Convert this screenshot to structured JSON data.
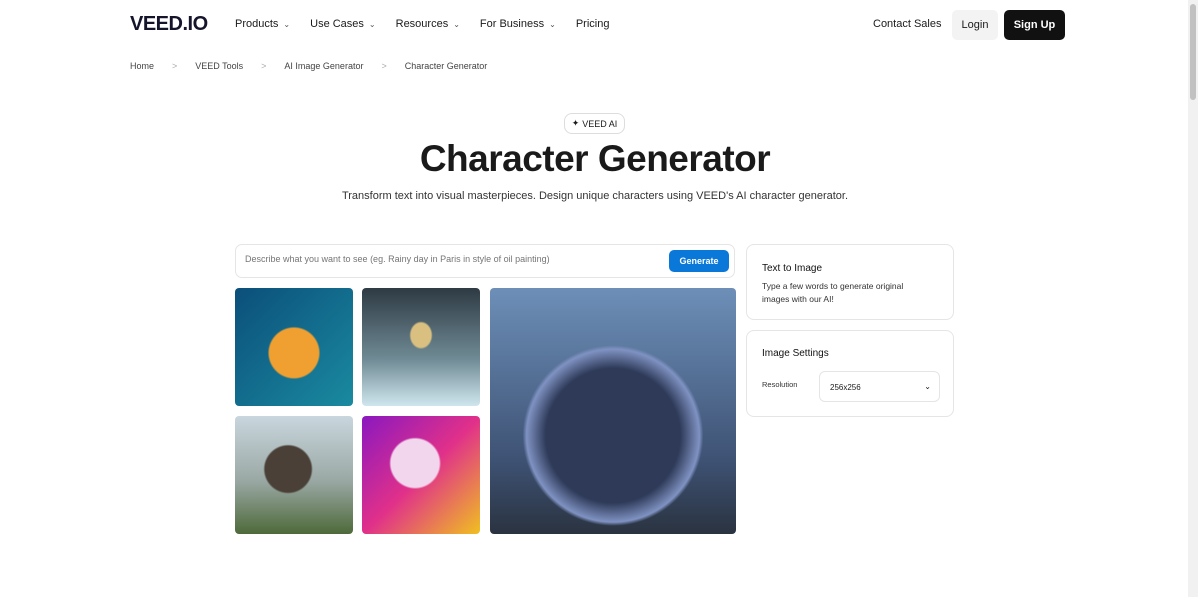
{
  "nav": {
    "logo": "VEED.IO",
    "items": [
      "Products",
      "Use Cases",
      "Resources",
      "For Business",
      "Pricing"
    ],
    "contact": "Contact Sales",
    "login": "Login",
    "signup": "Sign Up"
  },
  "breadcrumb": [
    "Home",
    "VEED Tools",
    "AI Image Generator",
    "Character Generator"
  ],
  "hero": {
    "badge": "VEED AI",
    "title": "Character Generator",
    "subtitle": "Transform text into visual masterpieces. Design unique characters using VEED's AI character generator."
  },
  "prompt": {
    "placeholder": "Describe what you want to see (eg. Rainy day in Paris in style of oil painting)",
    "button": "Generate"
  },
  "cards": {
    "text_title": "Text to Image",
    "text_desc": "Type a few words to generate original images with our AI!",
    "settings_title": "Image Settings",
    "resolution_label": "Resolution",
    "resolution_value": "256x256"
  },
  "accent": "#0a78d8"
}
